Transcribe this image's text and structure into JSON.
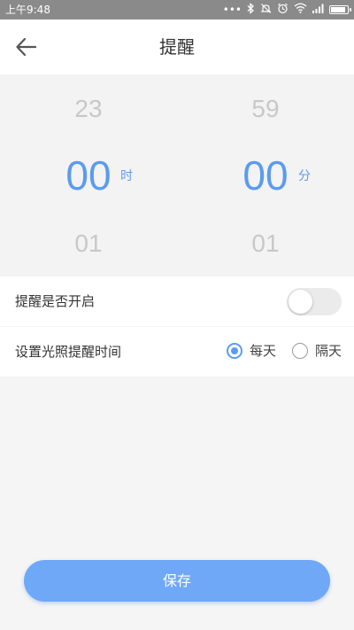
{
  "status_bar": {
    "time": "上午9:48",
    "icons": [
      "more-dots-icon",
      "bluetooth-icon",
      "mute-icon",
      "alarm-icon",
      "wifi-icon",
      "signal-icon",
      "battery-icon"
    ]
  },
  "header": {
    "title": "提醒",
    "back_icon": "arrow-left-icon"
  },
  "picker": {
    "hours": {
      "prev": "23",
      "current": "00",
      "next": "01",
      "unit": "时"
    },
    "minutes": {
      "prev": "59",
      "current": "00",
      "next": "01",
      "unit": "分"
    }
  },
  "settings": {
    "reminder_label": "提醒是否开启",
    "reminder_enabled": false,
    "light_time_label": "设置光照提醒时间",
    "options": [
      {
        "label": "每天",
        "selected": true
      },
      {
        "label": "隔天",
        "selected": false
      }
    ]
  },
  "save_label": "保存",
  "colors": {
    "accent": "#5b9bf0",
    "button": "#6fa8f7",
    "status_bar": "#8a8a8a"
  }
}
